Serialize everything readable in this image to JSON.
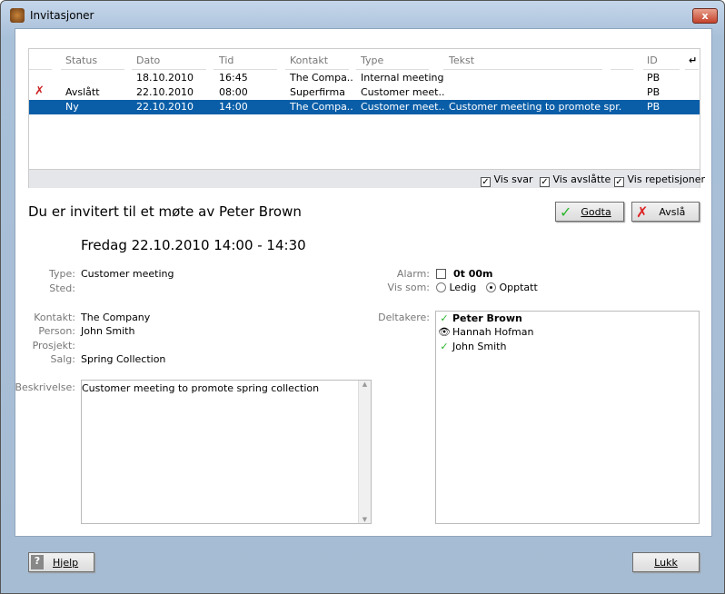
{
  "window": {
    "title": "Invitasjoner",
    "close_label": "x"
  },
  "grid": {
    "columns": [
      "Status",
      "Dato",
      "Tid",
      "Kontakt",
      "Type",
      "Tekst",
      "",
      "ID"
    ],
    "rows": [
      {
        "icon": "",
        "status": "",
        "dato": "18.10.2010",
        "tid": "16:45",
        "kontakt": "The Compa..",
        "type": "Internal meeting",
        "tekst": "",
        "id": "PB",
        "selected": false
      },
      {
        "icon": "declined-x-icon",
        "status": "Avslått",
        "dato": "22.10.2010",
        "tid": "08:00",
        "kontakt": "Superfirma",
        "type": "Customer meet..",
        "tekst": "",
        "id": "PB",
        "selected": false
      },
      {
        "icon": "",
        "status": "Ny",
        "dato": "22.10.2010",
        "tid": "14:00",
        "kontakt": "The Compa..",
        "type": "Customer meet..",
        "tekst": "Customer meeting to promote spr.",
        "id": "PB",
        "selected": true
      }
    ],
    "filters": [
      {
        "label": "Vis svar",
        "checked": true
      },
      {
        "label": "Vis avslåtte",
        "checked": true
      },
      {
        "label": "Vis repetisjoner",
        "checked": true
      }
    ]
  },
  "invite": {
    "heading": "Du er invitert til et møte av Peter Brown",
    "when": "Fredag 22.10.2010 14:00 - 14:30",
    "accept_label": "Godta",
    "decline_label": "Avslå",
    "labels": {
      "type": "Type:",
      "sted": "Sted:",
      "kontakt": "Kontakt:",
      "person": "Person:",
      "prosjekt": "Prosjekt:",
      "salg": "Salg:",
      "beskrivelse": "Beskrivelse:",
      "alarm": "Alarm:",
      "vis_som": "Vis som:",
      "deltakere": "Deltakere:"
    },
    "values": {
      "type": "Customer meeting",
      "sted": "",
      "kontakt": "The Company",
      "person": "John Smith",
      "prosjekt": "",
      "salg": "Spring Collection",
      "beskrivelse": "Customer meeting to promote spring collection"
    },
    "alarm": {
      "checked": false,
      "value": "0t 00m"
    },
    "vis_som": {
      "options": [
        "Ledig",
        "Opptatt"
      ],
      "selected": "Opptatt"
    },
    "participants": [
      {
        "name": "Peter Brown",
        "icon": "check-icon",
        "bold": true
      },
      {
        "name": "Hannah Hofman",
        "icon": "eye-icon",
        "bold": false
      },
      {
        "name": "John Smith",
        "icon": "check-icon",
        "bold": false
      }
    ]
  },
  "footer": {
    "help_label": "Hjelp",
    "close_label": "Lukk"
  }
}
